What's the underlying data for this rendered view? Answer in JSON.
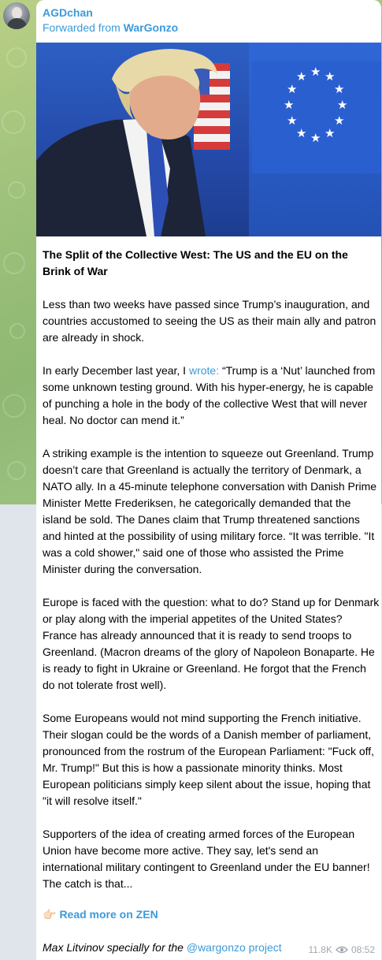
{
  "channel": {
    "sender_name": "AGDchan",
    "forwarded_prefix": "Forwarded from ",
    "forwarded_source": "WarGonzo"
  },
  "post": {
    "title": "The Split of the Collective West: The US and the EU on the Brink of War",
    "p1": "Less than two weeks have passed since Trump’s inauguration, and countries accustomed to seeing the US as their main ally and patron are already in shock.",
    "p2_before": "In early December last year, I ",
    "p2_link": "wrote:",
    "p2_after": " “Trump is a ‘Nut’ launched from some unknown testing ground. With his hyper-energy, he is capable of punching a hole in the body of the collective West that will never heal. No doctor can mend it.”",
    "p3": "A striking example is the intention to squeeze out Greenland. Trump doesn’t care that Greenland is actually the territory of Denmark, a NATO ally. In a 45-minute telephone conversation with Danish Prime Minister Mette Frederiksen, he categorically demanded that the island be sold. The Danes claim that Trump threatened sanctions and hinted at the possibility of using military force. “It was terrible. \"It was a cold shower,\" said one of those who assisted the Prime Minister during the conversation.",
    "p4": "Europe is faced with the question: what to do? Stand up for Denmark or play along with the imperial appetites of the United States? France has already announced that it is ready to send troops to Greenland. (Macron dreams of the glory of Napoleon Bonaparte. He is ready to fight in Ukraine or Greenland. He forgot that the French do not tolerate frost well).",
    "p5": "Some Europeans would not mind supporting the French initiative. Their slogan could be the words of a Danish member of parliament, pronounced from the rostrum of the European Parliament: \"Fuck off, Mr. Trump!\" But this is how a passionate minority thinks. Most European politicians simply keep silent about the issue, hoping that \"it will resolve itself.\"",
    "p6": "Supporters of the idea of creating armed forces of the European Union have become more active. They say, let's send an international military contingent to Greenland under the EU banner! The catch is that...",
    "read_more_icon": "👉🏻",
    "read_more": "Read more on ZEN",
    "signature_text": "Max Litvinov specially for the ",
    "signature_link": "@wargonzo project",
    "views": "11.8K",
    "time": "08:52"
  },
  "colors": {
    "link": "#3c9ad8",
    "meta": "#a0a8b0"
  },
  "icons": {
    "avatar": "channel-avatar",
    "views": "eye-icon",
    "read_more": "pointing-hand-icon"
  }
}
